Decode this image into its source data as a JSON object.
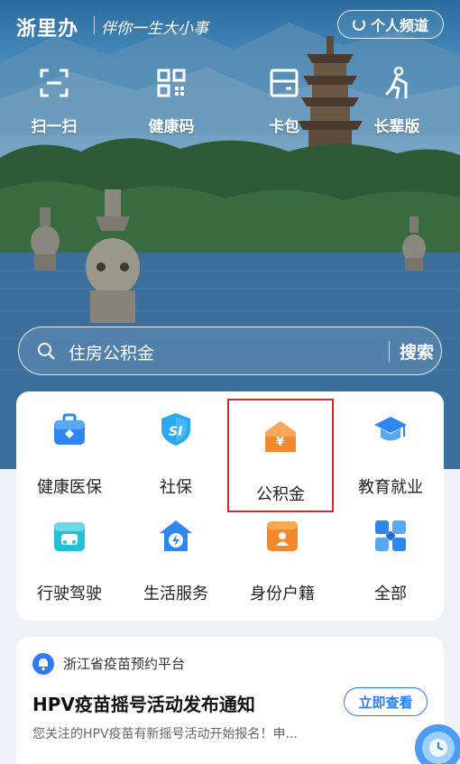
{
  "header": {
    "brand": "浙里办",
    "slogan": "伴你一生大小事",
    "personal_channel": "个人频道"
  },
  "quick_actions": [
    {
      "label": "扫一扫",
      "icon": "scan-icon"
    },
    {
      "label": "健康码",
      "icon": "qrcode-icon"
    },
    {
      "label": "卡包",
      "icon": "card-wallet-icon"
    },
    {
      "label": "长辈版",
      "icon": "elder-mode-icon"
    }
  ],
  "search": {
    "placeholder": "住房公积金",
    "button": "搜索"
  },
  "services": [
    {
      "label": "健康医保",
      "icon": "medical-kit-icon",
      "color": "#2e86f0"
    },
    {
      "label": "社保",
      "icon": "social-security-shield-icon",
      "color": "#2aa8f2"
    },
    {
      "label": "公积金",
      "icon": "housing-fund-icon",
      "color": "#f08a2c"
    },
    {
      "label": "教育就业",
      "icon": "graduation-cap-icon",
      "color": "#2e86f0"
    },
    {
      "label": "行驶驾驶",
      "icon": "car-card-icon",
      "color": "#25bfd6"
    },
    {
      "label": "生活服务",
      "icon": "house-lightning-icon",
      "color": "#2e86f0"
    },
    {
      "label": "身份户籍",
      "icon": "id-card-icon",
      "color": "#f08a2c"
    },
    {
      "label": "全部",
      "icon": "grid-all-icon",
      "color": "#2e86f0"
    }
  ],
  "notice": {
    "source": "浙江省疫苗预约平台",
    "title": "HPV疫苗摇号活动发布通知",
    "description": "您关注的HPV疫苗有新摇号活动开始报名！申...",
    "button": "立即查看"
  },
  "colors": {
    "accent": "#2d7cf6",
    "highlight_border": "#c9302c"
  }
}
